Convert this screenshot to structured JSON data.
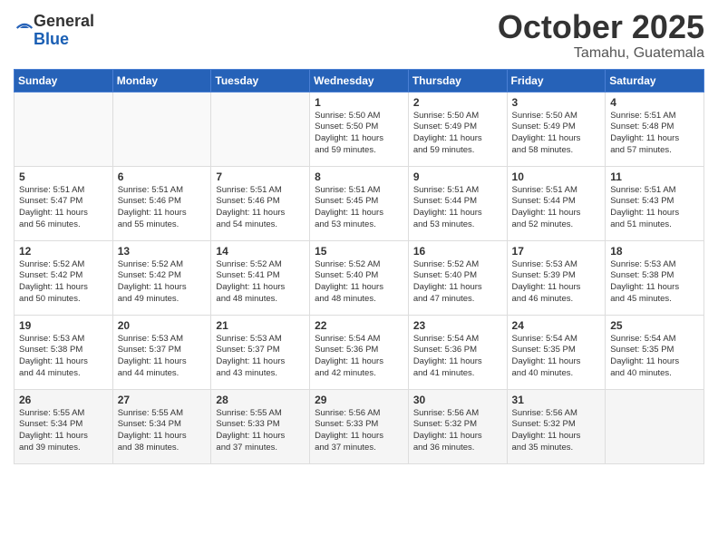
{
  "logo": {
    "general": "General",
    "blue": "Blue"
  },
  "header": {
    "month": "October 2025",
    "location": "Tamahu, Guatemala"
  },
  "weekdays": [
    "Sunday",
    "Monday",
    "Tuesday",
    "Wednesday",
    "Thursday",
    "Friday",
    "Saturday"
  ],
  "weeks": [
    [
      {
        "day": "",
        "text": ""
      },
      {
        "day": "",
        "text": ""
      },
      {
        "day": "",
        "text": ""
      },
      {
        "day": "1",
        "text": "Sunrise: 5:50 AM\nSunset: 5:50 PM\nDaylight: 11 hours\nand 59 minutes."
      },
      {
        "day": "2",
        "text": "Sunrise: 5:50 AM\nSunset: 5:49 PM\nDaylight: 11 hours\nand 59 minutes."
      },
      {
        "day": "3",
        "text": "Sunrise: 5:50 AM\nSunset: 5:49 PM\nDaylight: 11 hours\nand 58 minutes."
      },
      {
        "day": "4",
        "text": "Sunrise: 5:51 AM\nSunset: 5:48 PM\nDaylight: 11 hours\nand 57 minutes."
      }
    ],
    [
      {
        "day": "5",
        "text": "Sunrise: 5:51 AM\nSunset: 5:47 PM\nDaylight: 11 hours\nand 56 minutes."
      },
      {
        "day": "6",
        "text": "Sunrise: 5:51 AM\nSunset: 5:46 PM\nDaylight: 11 hours\nand 55 minutes."
      },
      {
        "day": "7",
        "text": "Sunrise: 5:51 AM\nSunset: 5:46 PM\nDaylight: 11 hours\nand 54 minutes."
      },
      {
        "day": "8",
        "text": "Sunrise: 5:51 AM\nSunset: 5:45 PM\nDaylight: 11 hours\nand 53 minutes."
      },
      {
        "day": "9",
        "text": "Sunrise: 5:51 AM\nSunset: 5:44 PM\nDaylight: 11 hours\nand 53 minutes."
      },
      {
        "day": "10",
        "text": "Sunrise: 5:51 AM\nSunset: 5:44 PM\nDaylight: 11 hours\nand 52 minutes."
      },
      {
        "day": "11",
        "text": "Sunrise: 5:51 AM\nSunset: 5:43 PM\nDaylight: 11 hours\nand 51 minutes."
      }
    ],
    [
      {
        "day": "12",
        "text": "Sunrise: 5:52 AM\nSunset: 5:42 PM\nDaylight: 11 hours\nand 50 minutes."
      },
      {
        "day": "13",
        "text": "Sunrise: 5:52 AM\nSunset: 5:42 PM\nDaylight: 11 hours\nand 49 minutes."
      },
      {
        "day": "14",
        "text": "Sunrise: 5:52 AM\nSunset: 5:41 PM\nDaylight: 11 hours\nand 48 minutes."
      },
      {
        "day": "15",
        "text": "Sunrise: 5:52 AM\nSunset: 5:40 PM\nDaylight: 11 hours\nand 48 minutes."
      },
      {
        "day": "16",
        "text": "Sunrise: 5:52 AM\nSunset: 5:40 PM\nDaylight: 11 hours\nand 47 minutes."
      },
      {
        "day": "17",
        "text": "Sunrise: 5:53 AM\nSunset: 5:39 PM\nDaylight: 11 hours\nand 46 minutes."
      },
      {
        "day": "18",
        "text": "Sunrise: 5:53 AM\nSunset: 5:38 PM\nDaylight: 11 hours\nand 45 minutes."
      }
    ],
    [
      {
        "day": "19",
        "text": "Sunrise: 5:53 AM\nSunset: 5:38 PM\nDaylight: 11 hours\nand 44 minutes."
      },
      {
        "day": "20",
        "text": "Sunrise: 5:53 AM\nSunset: 5:37 PM\nDaylight: 11 hours\nand 44 minutes."
      },
      {
        "day": "21",
        "text": "Sunrise: 5:53 AM\nSunset: 5:37 PM\nDaylight: 11 hours\nand 43 minutes."
      },
      {
        "day": "22",
        "text": "Sunrise: 5:54 AM\nSunset: 5:36 PM\nDaylight: 11 hours\nand 42 minutes."
      },
      {
        "day": "23",
        "text": "Sunrise: 5:54 AM\nSunset: 5:36 PM\nDaylight: 11 hours\nand 41 minutes."
      },
      {
        "day": "24",
        "text": "Sunrise: 5:54 AM\nSunset: 5:35 PM\nDaylight: 11 hours\nand 40 minutes."
      },
      {
        "day": "25",
        "text": "Sunrise: 5:54 AM\nSunset: 5:35 PM\nDaylight: 11 hours\nand 40 minutes."
      }
    ],
    [
      {
        "day": "26",
        "text": "Sunrise: 5:55 AM\nSunset: 5:34 PM\nDaylight: 11 hours\nand 39 minutes."
      },
      {
        "day": "27",
        "text": "Sunrise: 5:55 AM\nSunset: 5:34 PM\nDaylight: 11 hours\nand 38 minutes."
      },
      {
        "day": "28",
        "text": "Sunrise: 5:55 AM\nSunset: 5:33 PM\nDaylight: 11 hours\nand 37 minutes."
      },
      {
        "day": "29",
        "text": "Sunrise: 5:56 AM\nSunset: 5:33 PM\nDaylight: 11 hours\nand 37 minutes."
      },
      {
        "day": "30",
        "text": "Sunrise: 5:56 AM\nSunset: 5:32 PM\nDaylight: 11 hours\nand 36 minutes."
      },
      {
        "day": "31",
        "text": "Sunrise: 5:56 AM\nSunset: 5:32 PM\nDaylight: 11 hours\nand 35 minutes."
      },
      {
        "day": "",
        "text": ""
      }
    ]
  ]
}
